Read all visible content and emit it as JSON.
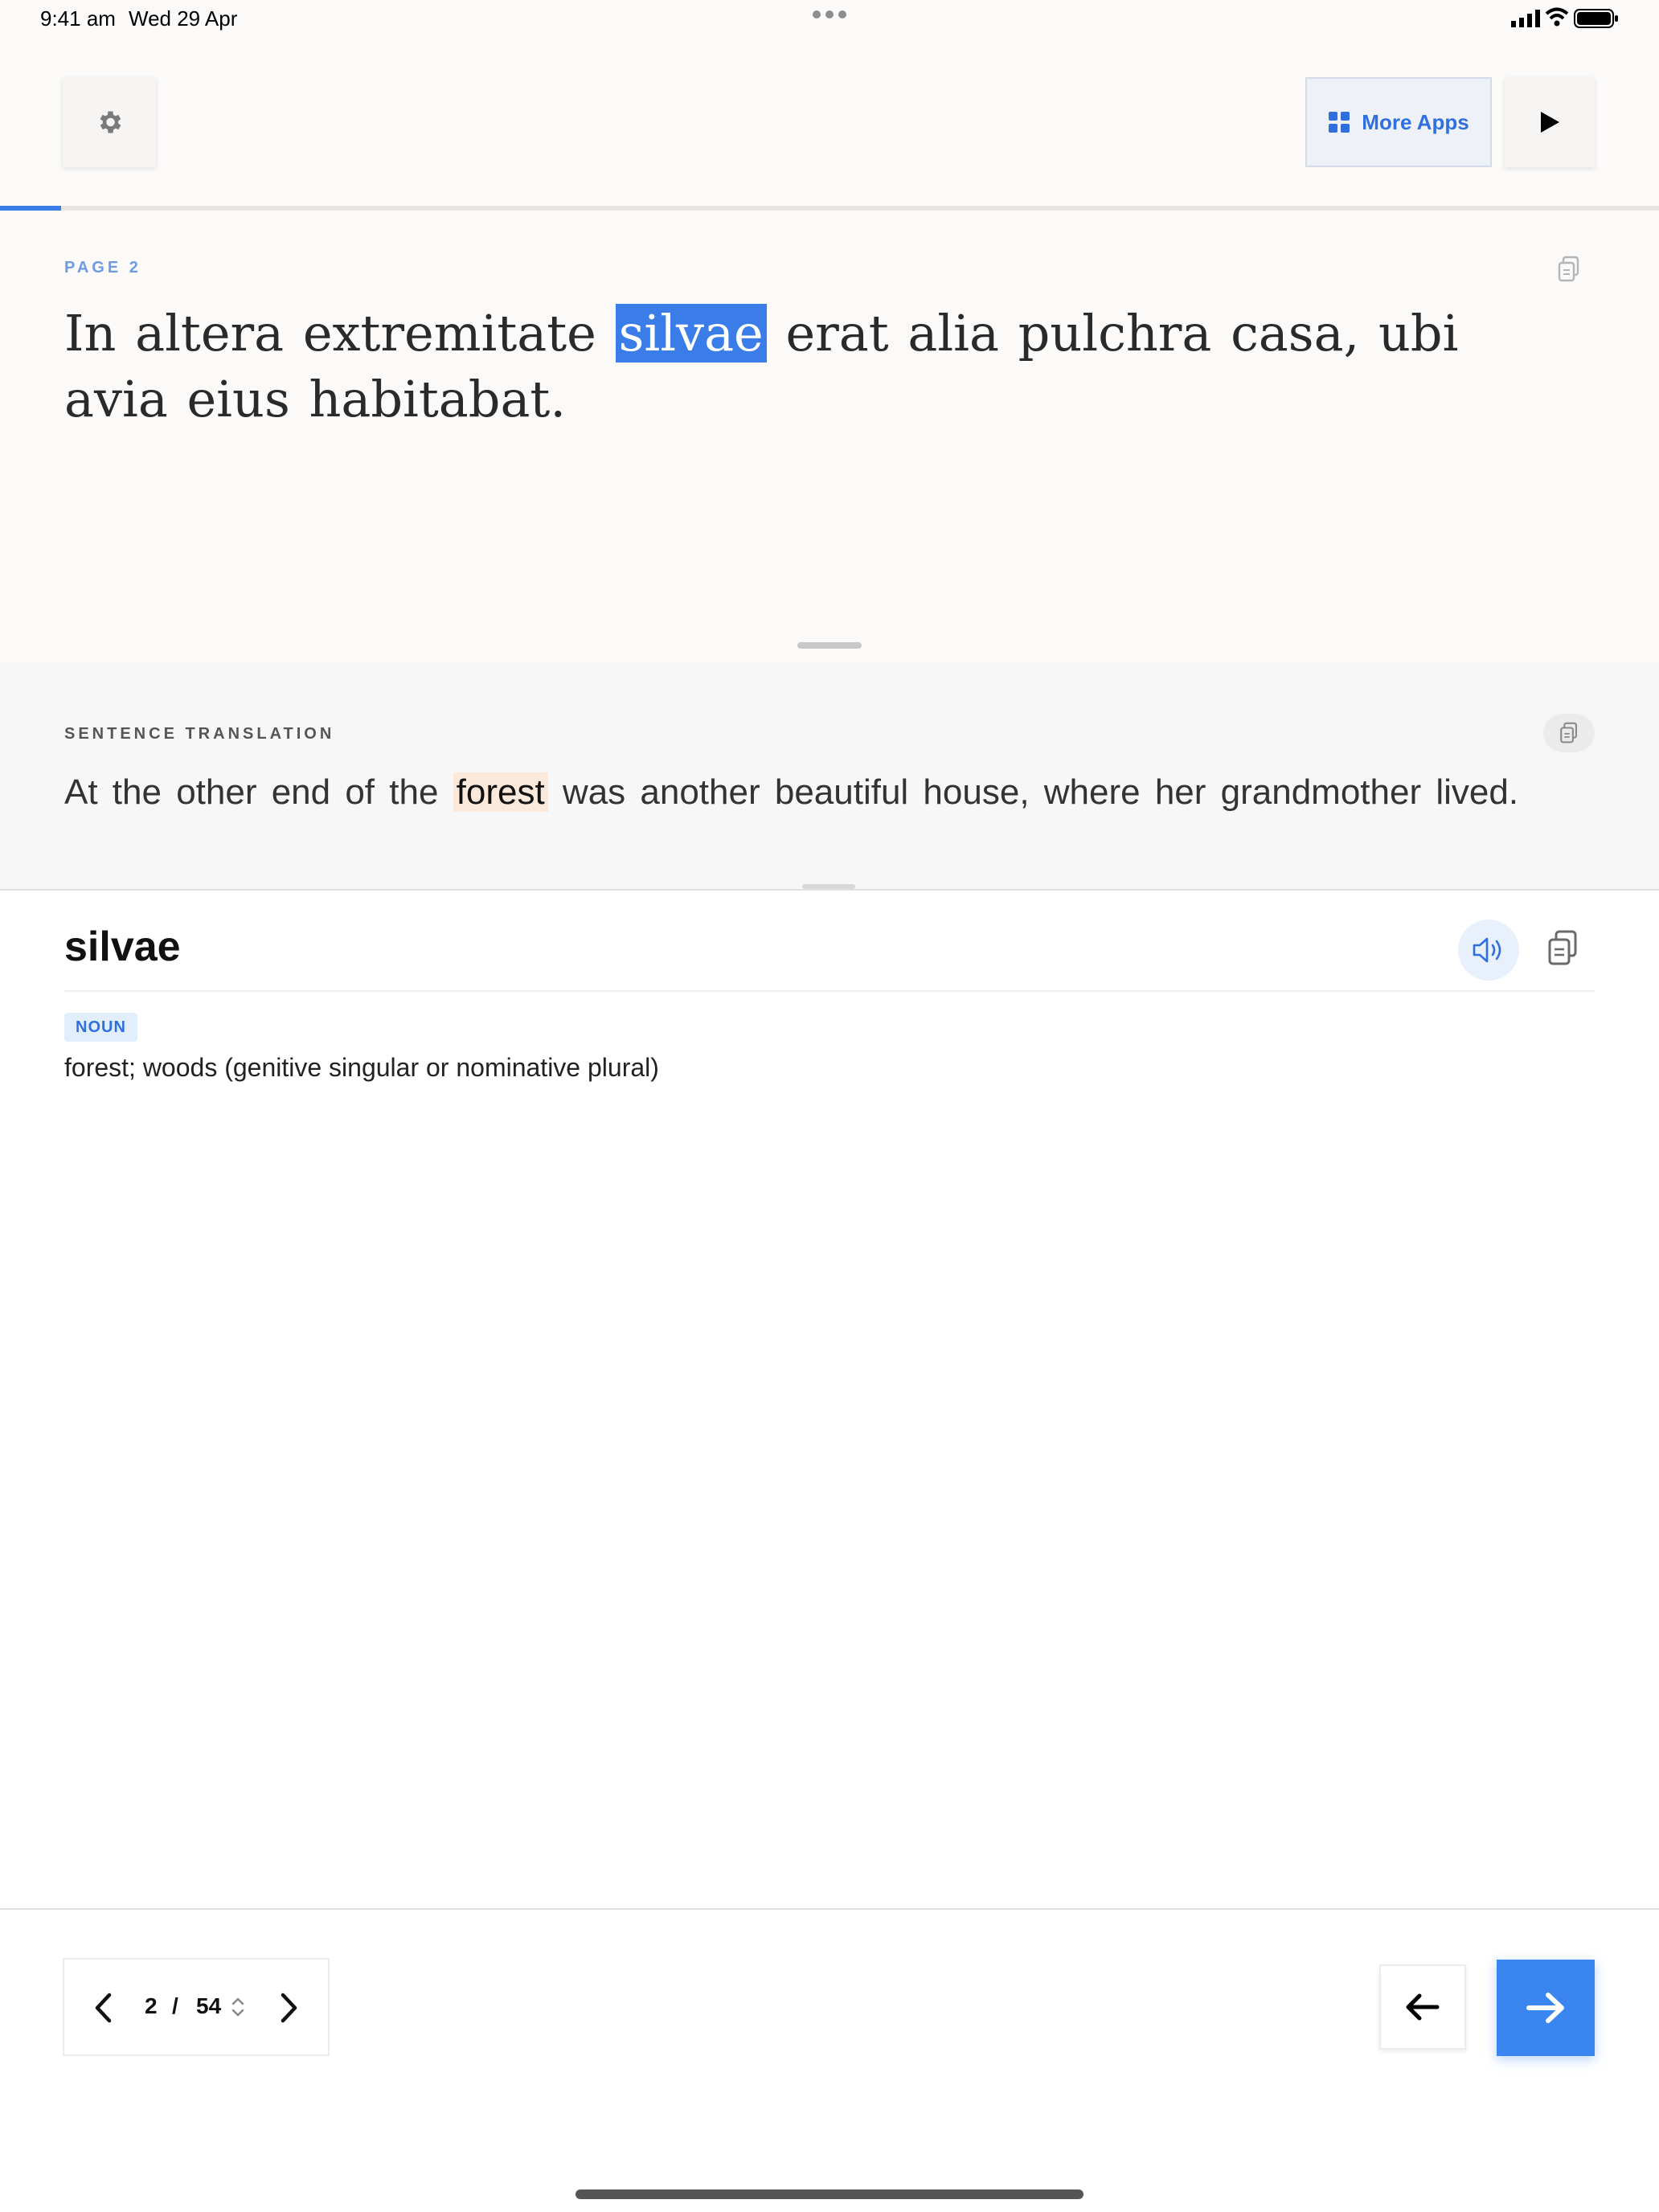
{
  "status_bar": {
    "time": "9:41 am",
    "date": "Wed 29 Apr"
  },
  "toolbar": {
    "settings_icon": "gear-icon",
    "more_apps_label": "More Apps",
    "more_apps_icon": "grid-icon",
    "play_icon": "play-icon"
  },
  "progress": {
    "fraction": 0.037,
    "color": "#3a7de8"
  },
  "reader": {
    "page_label": "PAGE 2",
    "text_before": "In altera extremitate ",
    "highlighted_word": "silvae",
    "text_after": " erat alia pulchra casa, ubi avia eius habitabat."
  },
  "translation": {
    "label": "SENTENCE TRANSLATION",
    "text_before": "At the other end of the ",
    "highlighted_word": "forest",
    "text_after": " was another beautiful house, where her grandmother lived."
  },
  "dictionary": {
    "word": "silvae",
    "part_of_speech": "NOUN",
    "definition": "forest; woods (genitive singular or nominative plural)"
  },
  "pager": {
    "current": "2",
    "separator": "/",
    "total": "54"
  },
  "colors": {
    "accent": "#3a7de8",
    "highlight_translation": "#fbe9dc"
  }
}
